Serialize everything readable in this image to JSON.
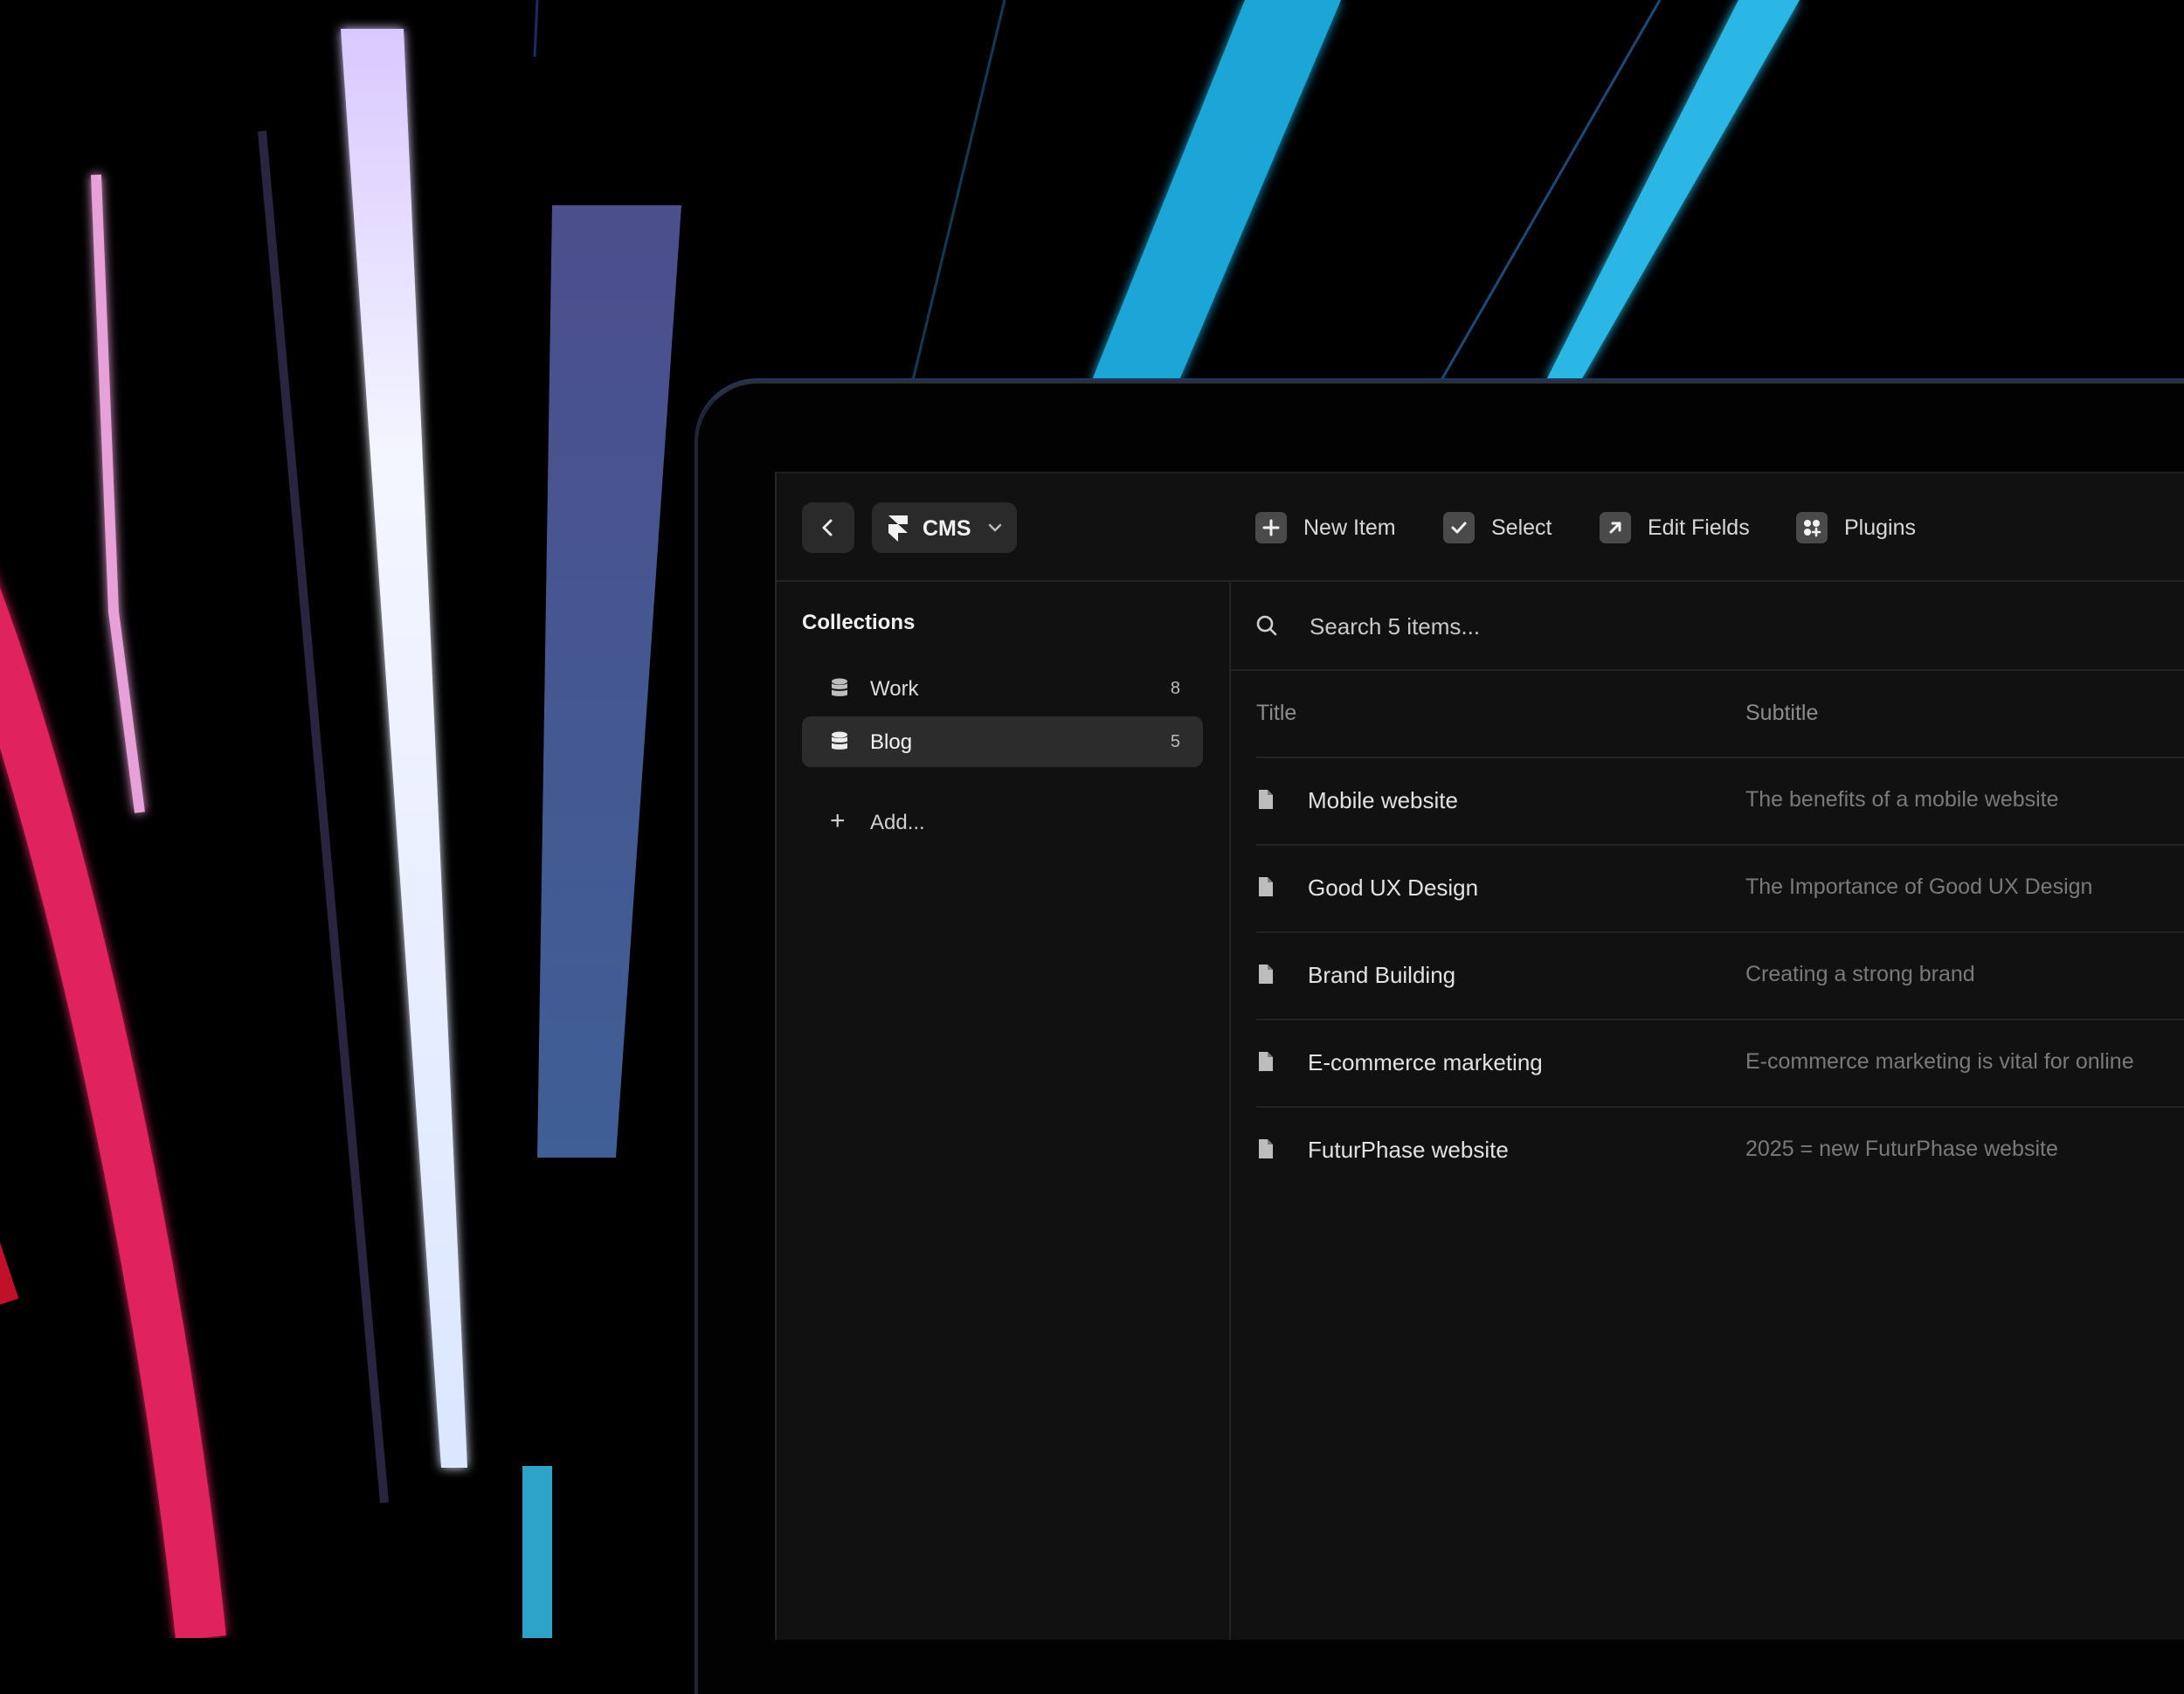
{
  "toolbar": {
    "app_menu_label": "CMS",
    "actions": [
      {
        "label": "New Item",
        "icon": "plus-square-icon"
      },
      {
        "label": "Select",
        "icon": "checkbox-icon"
      },
      {
        "label": "Edit Fields",
        "icon": "arrow-up-right-square-icon"
      },
      {
        "label": "Plugins",
        "icon": "plugins-grid-icon"
      }
    ]
  },
  "sidebar": {
    "title": "Collections",
    "items": [
      {
        "label": "Work",
        "count": "8",
        "active": false
      },
      {
        "label": "Blog",
        "count": "5",
        "active": true
      }
    ],
    "add_label": "Add..."
  },
  "search": {
    "placeholder": "Search 5 items..."
  },
  "table": {
    "columns": [
      "Title",
      "Subtitle"
    ],
    "rows": [
      {
        "title": "Mobile website",
        "subtitle": "The benefits of a mobile website"
      },
      {
        "title": "Good UX Design",
        "subtitle": "The Importance of Good UX Design"
      },
      {
        "title": "Brand Building",
        "subtitle": "Creating a strong brand"
      },
      {
        "title": "E-commerce marketing",
        "subtitle": "E-commerce marketing is vital for online"
      },
      {
        "title": "FuturPhase website",
        "subtitle": "2025 = new FuturPhase website"
      }
    ]
  },
  "colors": {
    "background": "#000000",
    "app_surface": "#111111",
    "active_item": "#2c2c2c",
    "neon_cyan": "#1aa6d8",
    "neon_pink": "#e0225e",
    "neon_white": "#eef2ff",
    "neon_lavender": "#4a5a9a"
  }
}
